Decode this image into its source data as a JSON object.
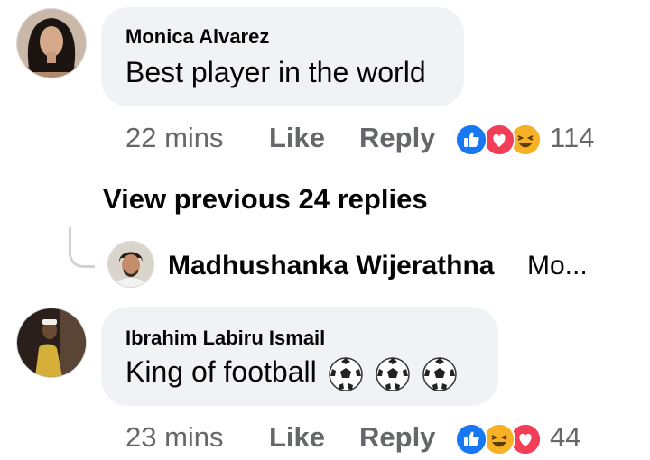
{
  "comments": [
    {
      "author": "Monica Alvarez",
      "text": "Best player in the world",
      "time": "22 mins",
      "like_label": "Like",
      "reply_label": "Reply",
      "reaction_icons": [
        "like-icon",
        "love-icon",
        "haha-icon"
      ],
      "reaction_count": "114"
    },
    {
      "author": "Ibrahim Labiru Ismail",
      "text": "King of football",
      "text_emoji": [
        "soccer-ball-icon",
        "soccer-ball-icon",
        "soccer-ball-icon"
      ],
      "time": "23 mins",
      "like_label": "Like",
      "reply_label": "Reply",
      "reaction_icons": [
        "like-icon",
        "haha-icon",
        "love-icon"
      ],
      "reaction_count": "44"
    }
  ],
  "thread": {
    "view_previous_label": "View previous 24 replies",
    "latest_reply_author": "Madhushanka Wijerathna",
    "latest_reply_snippet": "Mo..."
  },
  "colors": {
    "bubble": "#f0f2f5",
    "meta_text": "#65676b",
    "like_blue": "#1877f2",
    "love_red": "#f33e58",
    "haha_yellow": "#f7b125"
  }
}
